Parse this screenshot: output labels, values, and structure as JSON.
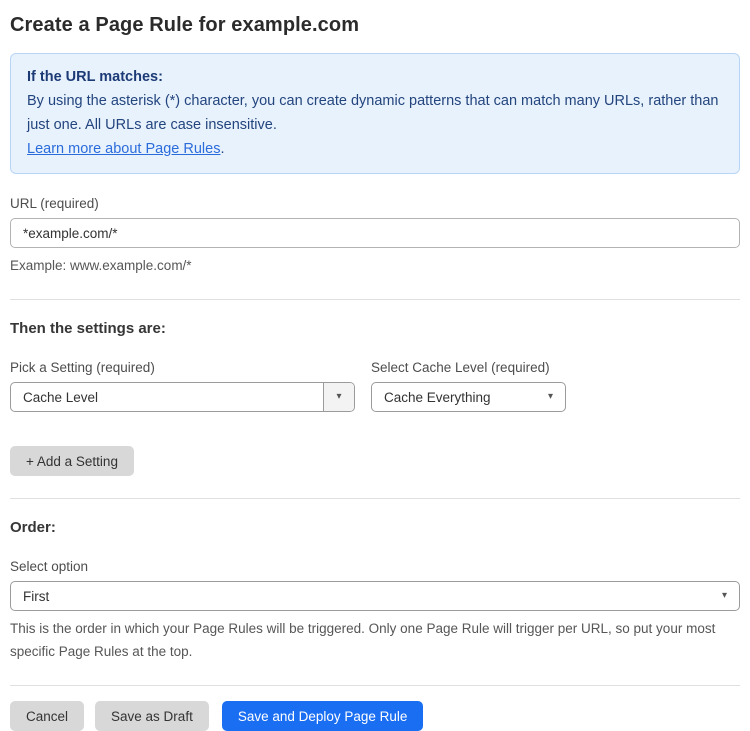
{
  "page": {
    "title": "Create a Page Rule for example.com"
  },
  "info_box": {
    "heading": "If the URL matches:",
    "body": "By using the asterisk (*) character, you can create dynamic patterns that can match many URLs, rather than just one. All URLs are case insensitive.",
    "link": "Learn more about Page Rules",
    "link_suffix": "."
  },
  "url_field": {
    "label": "URL (required)",
    "value": "*example.com/*",
    "helper": "Example: www.example.com/*"
  },
  "settings": {
    "heading": "Then the settings are:",
    "pick_setting": {
      "label": "Pick a Setting (required)",
      "value": "Cache Level"
    },
    "cache_level": {
      "label": "Select Cache Level (required)",
      "value": "Cache Everything"
    },
    "add_button": "+ Add a Setting"
  },
  "order": {
    "heading": "Order:",
    "label": "Select option",
    "value": "First",
    "helper": "This is the order in which your Page Rules will be triggered. Only one Page Rule will trigger per URL, so put your most specific Page Rules at the top."
  },
  "actions": {
    "cancel": "Cancel",
    "save_draft": "Save as Draft",
    "save_deploy": "Save and Deploy Page Rule"
  },
  "icons": {
    "dropdown_arrow": "▾"
  },
  "colors": {
    "accent_blue": "#1a6ef2",
    "link_blue": "#2b6cdb",
    "info_background": "#e8f2fd",
    "info_border": "#b9d5f6",
    "info_text": "#23457e",
    "button_gray": "#d8d8d8"
  }
}
